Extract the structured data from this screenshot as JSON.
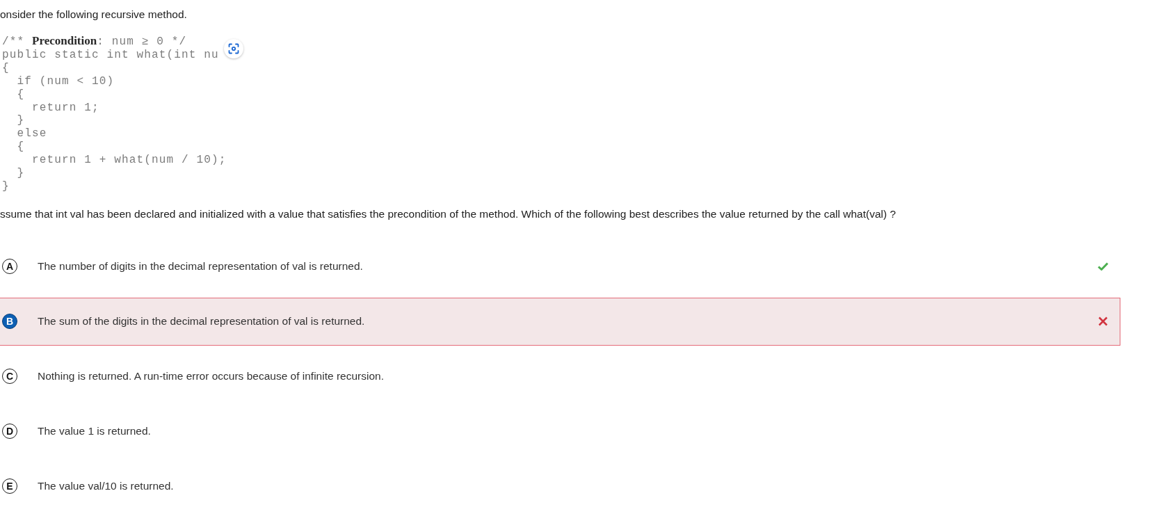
{
  "intro": "onsider the following recursive method.",
  "code": {
    "lines": [
      "/** **Precondition**: num ≥ 0 */",
      "public static int what(int nu",
      "{",
      "  if (num < 10)",
      "  {",
      "    return 1;",
      "  }",
      "  else",
      "  {",
      "    return 1 + what(num / 10);",
      "  }",
      "}"
    ]
  },
  "question": "ssume that int val has been declared and initialized with a value that satisfies the precondition of the method. Which of the following best describes the value returned by the call what(val) ?",
  "options": [
    {
      "letter": "A",
      "text": "The number of digits in the decimal representation of val is returned.",
      "selected": false,
      "correct": true
    },
    {
      "letter": "B",
      "text": "The sum of the digits in the decimal representation of val is returned.",
      "selected": true,
      "correct": false
    },
    {
      "letter": "C",
      "text": "Nothing is returned. A run-time error occurs because of infinite recursion.",
      "selected": false,
      "correct": false
    },
    {
      "letter": "D",
      "text": "The value 1 is returned.",
      "selected": false,
      "correct": false
    },
    {
      "letter": "E",
      "text": "The value val/10 is returned.",
      "selected": false,
      "correct": false
    }
  ]
}
